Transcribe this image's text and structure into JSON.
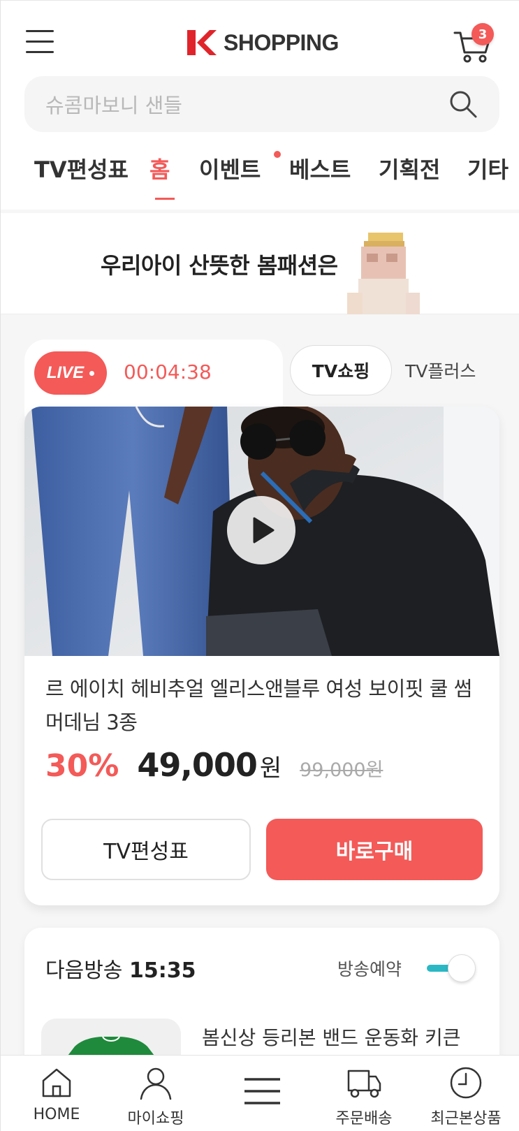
{
  "header": {
    "logo_text": "SHOPPING",
    "cart_count": "3",
    "search_placeholder": "슈콤마보니 샌들"
  },
  "tabs": [
    {
      "label": "TV편성표",
      "active": false
    },
    {
      "label": "홈",
      "active": true
    },
    {
      "label": "이벤트",
      "active": false,
      "dot": true
    },
    {
      "label": "베스트",
      "active": false
    },
    {
      "label": "기획전",
      "active": false
    },
    {
      "label": "기타",
      "active": false
    }
  ],
  "banner": {
    "text": "우리아이 산뜻한 봄패션은"
  },
  "live": {
    "badge": "LIVE",
    "timer": "00:04:38",
    "channel_tabs": [
      "TV쇼핑",
      "TV플러스"
    ],
    "product_name": "르 에이치 헤비추얼 엘리스앤블루 여성 보이핏 쿨 썸머데님 3종",
    "discount": "30%",
    "price": "49,000",
    "currency": "원",
    "original_price": "99,000원",
    "schedule_button": "TV편성표",
    "buy_button": "바로구매"
  },
  "next": {
    "title_prefix": "다음방송",
    "time": "15:35",
    "reserve_label": "방송예약",
    "product_name": "봄신상 등리본 밴드 운동화 키큰"
  },
  "bottom_nav": [
    {
      "label": "HOME",
      "icon": "home-icon"
    },
    {
      "label": "마이쇼핑",
      "icon": "person-icon"
    },
    {
      "label": "",
      "icon": "menu-icon"
    },
    {
      "label": "주문배송",
      "icon": "truck-icon"
    },
    {
      "label": "최근본상품",
      "icon": "clock-icon"
    }
  ],
  "colors": {
    "accent": "#f35a58",
    "toggle": "#2bb8c4"
  }
}
